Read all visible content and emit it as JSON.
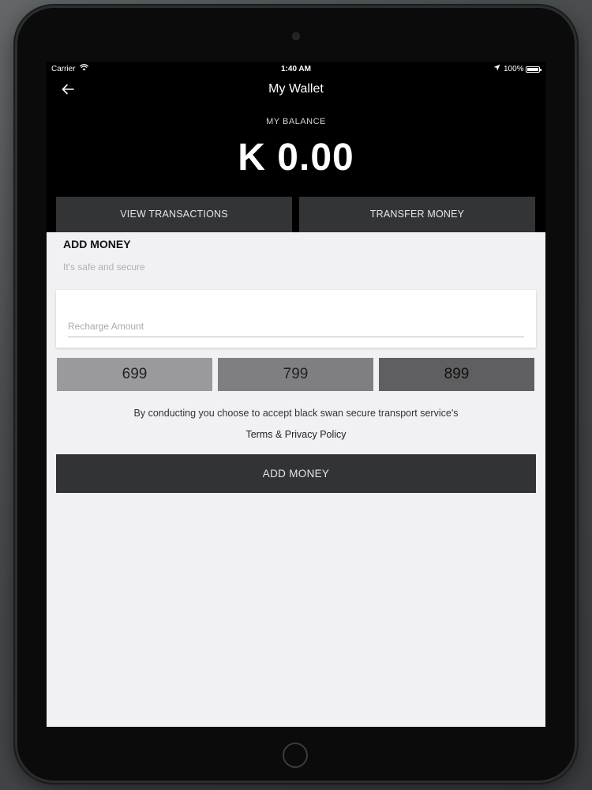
{
  "status_bar": {
    "carrier": "Carrier",
    "time": "1:40 AM",
    "battery": "100%",
    "icons": [
      "wifi-icon",
      "location-arrow-icon",
      "battery-icon"
    ]
  },
  "nav": {
    "title": "My Wallet",
    "back_icon": "arrow-left-icon"
  },
  "balance": {
    "label": "MY BALANCE",
    "amount": "K 0.00"
  },
  "header_actions": {
    "view_transactions": "VIEW TRANSACTIONS",
    "transfer_money": "TRANSFER MONEY"
  },
  "add_money": {
    "title": "ADD MONEY",
    "subtitle": "It's safe and secure",
    "input_placeholder": "Recharge Amount",
    "input_value": "",
    "presets": [
      "699",
      "799",
      "899"
    ],
    "terms_text": "By conducting you choose to accept black swan secure transport service's",
    "terms_link": "Terms & Privacy Policy",
    "button_label": "ADD MONEY"
  },
  "colors": {
    "header_bg": "#000000",
    "button_bg": "#333436",
    "screen_bg": "#f1f1f3",
    "preset_1": "#9a9a9c",
    "preset_2": "#7f7f81",
    "preset_3": "#5f5f61"
  }
}
